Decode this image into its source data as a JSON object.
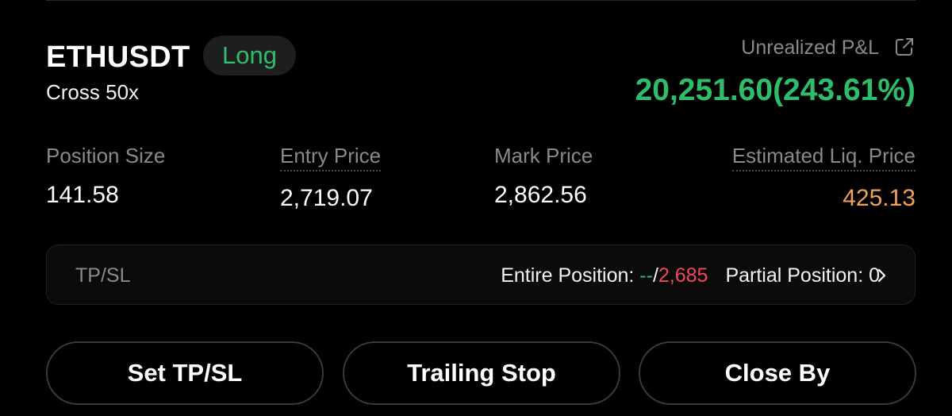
{
  "position": {
    "symbol": "ETHUSDT",
    "side": "Long",
    "margin_mode": "Cross 50x",
    "unrealized_pnl_label": "Unrealized P&L",
    "unrealized_pnl_value": "20,251.60(243.61%)"
  },
  "stats": {
    "position_size": {
      "label": "Position Size",
      "value": "141.58"
    },
    "entry_price": {
      "label": "Entry Price",
      "value": "2,719.07"
    },
    "mark_price": {
      "label": "Mark Price",
      "value": "2,862.56"
    },
    "liq_price": {
      "label": "Estimated Liq. Price",
      "value": "425.13"
    }
  },
  "tpsl": {
    "label": "TP/SL",
    "entire_label": "Entire Position: ",
    "entire_tp": "--",
    "separator": "/",
    "entire_sl": "2,685",
    "partial_label": "Partial Position: 0"
  },
  "buttons": {
    "set_tpsl": "Set TP/SL",
    "trailing_stop": "Trailing Stop",
    "close_by": "Close By"
  },
  "icons": {
    "share": "external-link-icon",
    "chevron": "chevron-right-icon"
  },
  "colors": {
    "profit_green": "#2ebd6b",
    "loss_red": "#f6465d",
    "liq_orange": "#f0a15a",
    "muted_gray": "#8a8a8a",
    "background": "#000000"
  }
}
